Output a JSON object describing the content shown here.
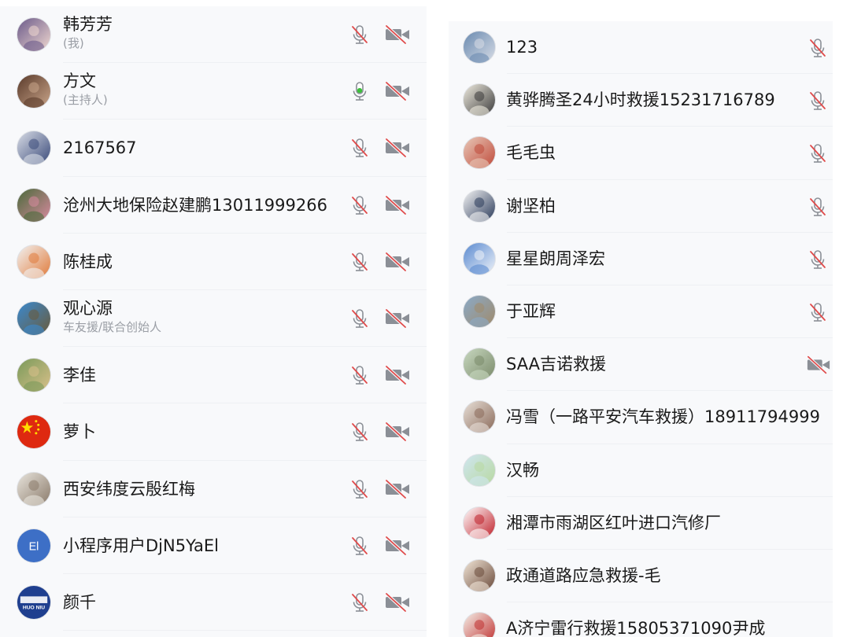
{
  "left": [
    {
      "name": "韩芳芳",
      "sub": "(我)",
      "mic": "mic-muted-icon",
      "cam": "camera-off-icon",
      "avatar": {
        "kind": "photo",
        "c1": "#6b5a8a",
        "c2": "#f0d8d0"
      }
    },
    {
      "name": "方文",
      "sub": "(主持人)",
      "mic": "mic-active-icon",
      "cam": "camera-off-icon",
      "avatar": {
        "kind": "photo",
        "c1": "#5a3a2a",
        "c2": "#c9a58a"
      }
    },
    {
      "name": "2167567",
      "sub": "",
      "mic": "mic-muted-icon",
      "cam": "camera-off-icon",
      "avatar": {
        "kind": "photo",
        "c1": "#d9dde6",
        "c2": "#3a4a7a"
      }
    },
    {
      "name": "沧州大地保险赵建鹏13011999266",
      "sub": "",
      "mic": "mic-muted-icon",
      "cam": "camera-off-icon",
      "avatar": {
        "kind": "photo",
        "c1": "#4a6a3a",
        "c2": "#d98aa0"
      }
    },
    {
      "name": "陈桂成",
      "sub": "",
      "mic": "mic-muted-icon",
      "cam": "camera-off-icon",
      "avatar": {
        "kind": "photo",
        "c1": "#f2f2f2",
        "c2": "#e07a3a"
      }
    },
    {
      "name": "观心源",
      "sub": "车友援/联合创始人",
      "mic": "mic-muted-icon",
      "cam": "camera-off-icon",
      "avatar": {
        "kind": "photo",
        "c1": "#3a8ad0",
        "c2": "#6a5a3a"
      }
    },
    {
      "name": "李佳",
      "sub": "",
      "mic": "mic-muted-icon",
      "cam": "camera-off-icon",
      "avatar": {
        "kind": "photo",
        "c1": "#7a9a5a",
        "c2": "#d9c08a"
      }
    },
    {
      "name": "萝卜",
      "sub": "",
      "mic": "mic-muted-icon",
      "cam": "camera-off-icon",
      "avatar": {
        "kind": "flag",
        "c1": "#de2910",
        "c2": "#ffde00"
      }
    },
    {
      "name": "西安纬度云殷红梅",
      "sub": "",
      "mic": "mic-muted-icon",
      "cam": "camera-off-icon",
      "avatar": {
        "kind": "photo",
        "c1": "#e8e4dc",
        "c2": "#8a7a6a"
      }
    },
    {
      "name": "小程序用户DjN5YaEl",
      "sub": "",
      "mic": "mic-muted-icon",
      "cam": "camera-off-icon",
      "avatar": {
        "kind": "initials",
        "text": "El",
        "c1": "#3d6fc6",
        "c2": "#ffffff"
      }
    },
    {
      "name": "颜千",
      "sub": "",
      "mic": "mic-muted-icon",
      "cam": "camera-off-icon",
      "avatar": {
        "kind": "logo",
        "text": "HUO NIU",
        "c1": "#1f3f8f",
        "c2": "#ffffff"
      }
    }
  ],
  "right": [
    {
      "name": "123",
      "mic": "mic-muted-icon",
      "cam": "",
      "avatar": {
        "kind": "photo",
        "c1": "#6a8ab0",
        "c2": "#d8dde6"
      }
    },
    {
      "name": "黄骅腾圣24小时救援15231716789",
      "mic": "mic-muted-icon",
      "cam": "",
      "avatar": {
        "kind": "photo",
        "c1": "#f0ece0",
        "c2": "#3a3a3a"
      }
    },
    {
      "name": "毛毛虫",
      "mic": "mic-muted-icon",
      "cam": "",
      "avatar": {
        "kind": "photo",
        "c1": "#e8c8b8",
        "c2": "#c04a3a"
      }
    },
    {
      "name": "谢坚柏",
      "mic": "mic-muted-icon",
      "cam": "",
      "avatar": {
        "kind": "photo",
        "c1": "#f4f4f4",
        "c2": "#2a3a5a"
      }
    },
    {
      "name": "星星朗周泽宏",
      "mic": "mic-muted-icon",
      "cam": "",
      "avatar": {
        "kind": "photo",
        "c1": "#5a8ad0",
        "c2": "#eef2f8"
      }
    },
    {
      "name": "于亚辉",
      "mic": "mic-muted-icon",
      "cam": "",
      "avatar": {
        "kind": "photo",
        "c1": "#8aaac8",
        "c2": "#a08a6a"
      }
    },
    {
      "name": "SAA吉诺救援",
      "mic": "",
      "cam": "camera-off-icon",
      "avatar": {
        "kind": "photo",
        "c1": "#c8d8c0",
        "c2": "#7a8a6a"
      }
    },
    {
      "name": "冯雪（一路平安汽车救援）18911794999",
      "mic": "",
      "cam": "",
      "avatar": {
        "kind": "photo",
        "c1": "#e8e0d8",
        "c2": "#8a6a5a"
      }
    },
    {
      "name": "汉畅",
      "mic": "",
      "cam": "",
      "avatar": {
        "kind": "photo",
        "c1": "#cfe6f0",
        "c2": "#b8d8a0"
      }
    },
    {
      "name": "湘潭市雨湖区红叶进口汽修厂",
      "mic": "",
      "cam": "",
      "avatar": {
        "kind": "photo",
        "c1": "#ffffff",
        "c2": "#c0202a"
      }
    },
    {
      "name": "政通道路应急救援-毛",
      "mic": "",
      "cam": "",
      "avatar": {
        "kind": "photo",
        "c1": "#f2e6d8",
        "c2": "#6a4a3a"
      }
    },
    {
      "name": "A济宁雷行救援15805371090尹成",
      "mic": "",
      "cam": "",
      "avatar": {
        "kind": "photo",
        "c1": "#f4f0e8",
        "c2": "#c03030"
      }
    }
  ]
}
